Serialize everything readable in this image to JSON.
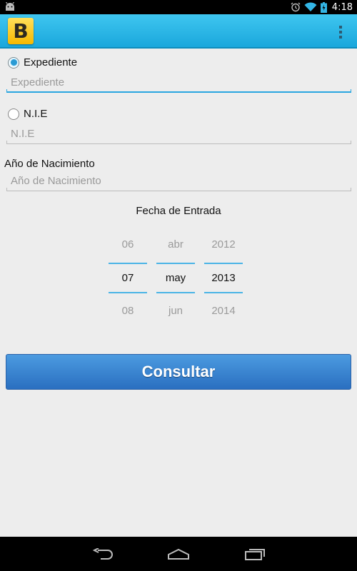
{
  "status_bar": {
    "time": "4:18"
  },
  "action_bar": {
    "app_icon_letter": "B",
    "overflow_icon": "overflow-menu-icon"
  },
  "form": {
    "expediente": {
      "radio_label": "Expediente",
      "placeholder": "Expediente",
      "checked": true
    },
    "nie": {
      "radio_label": "N.I.E",
      "placeholder": "N.I.E",
      "checked": false
    },
    "birth_year": {
      "label": "Año de Nacimiento",
      "placeholder": "Año de Nacimiento"
    },
    "entry_date": {
      "label": "Fecha de Entrada",
      "day": {
        "prev": "06",
        "selected": "07",
        "next": "08"
      },
      "month": {
        "prev": "abr",
        "selected": "may",
        "next": "jun"
      },
      "year": {
        "prev": "2012",
        "selected": "2013",
        "next": "2014"
      }
    },
    "submit_label": "Consultar"
  },
  "colors": {
    "accent": "#2aa6e0",
    "action_bar": "#1aa7dc",
    "button": "#3a85d0"
  }
}
